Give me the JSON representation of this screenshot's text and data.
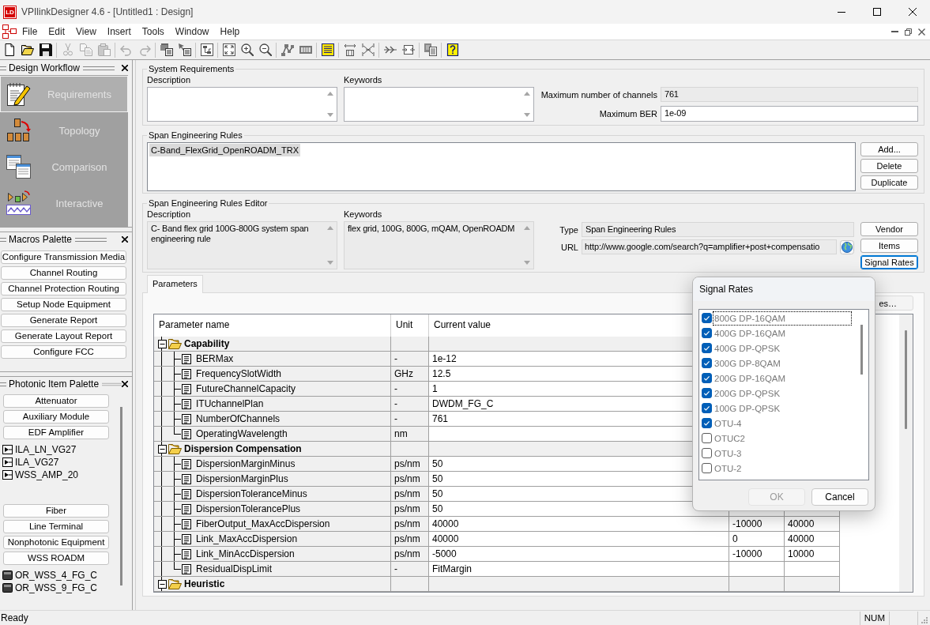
{
  "window": {
    "logo": "LD",
    "title": "VPIlinkDesigner 4.6 - [Untitled1 : Design]"
  },
  "menu": [
    "File",
    "Edit",
    "View",
    "Insert",
    "Tools",
    "Window",
    "Help"
  ],
  "toolbar": [
    [
      {
        "disabled": false
      },
      {
        "disabled": false
      },
      {
        "disabled": false
      }
    ],
    [
      {
        "disabled": true
      },
      {
        "disabled": true
      },
      {
        "disabled": true
      }
    ],
    [
      {
        "disabled": true
      },
      {
        "disabled": true
      }
    ],
    [
      {
        "disabled": false
      },
      {
        "disabled": false
      }
    ],
    [
      {
        "disabled": false
      }
    ],
    [
      {
        "disabled": false
      },
      {
        "disabled": false
      },
      {
        "disabled": false
      }
    ],
    [
      {
        "disabled": false
      },
      {
        "disabled": false
      }
    ],
    [
      {
        "disabled": false
      }
    ],
    [
      {
        "disabled": false
      },
      {
        "disabled": false
      }
    ],
    [
      {
        "disabled": false
      },
      {
        "disabled": false
      }
    ],
    [
      {
        "disabled": false
      }
    ],
    [
      {
        "disabled": false
      }
    ]
  ],
  "workflow": {
    "title": "Design Workflow",
    "items": [
      {
        "label": "Requirements",
        "selected": true
      },
      {
        "label": "Topology",
        "selected": false
      },
      {
        "label": "Comparison",
        "selected": false
      },
      {
        "label": "Interactive",
        "selected": false
      }
    ]
  },
  "macros_palette": {
    "title": "Macros Palette",
    "buttons": [
      "Configure Transmission Media",
      "Channel Routing",
      "Channel Protection Routing",
      "Setup Node Equipment",
      "Generate Report",
      "Generate Layout Report",
      "Configure FCC"
    ]
  },
  "photonic_palette": {
    "title": "Photonic Item Palette",
    "categories": [
      {
        "label": "Attenuator"
      },
      {
        "label": "Auxiliary Module"
      },
      {
        "label": "EDF Amplifier",
        "items": [
          {
            "label": "ILA_LN_VG27",
            "kind": "amplifier"
          },
          {
            "label": "ILA_VG27",
            "kind": "amplifier"
          },
          {
            "label": "WSS_AMP_20",
            "kind": "amplifier"
          }
        ]
      },
      {
        "label": "Fiber"
      },
      {
        "label": "Line Terminal"
      },
      {
        "label": "Nonphotonic Equipment"
      },
      {
        "label": "WSS ROADM",
        "items": [
          {
            "label": "OR_WSS_4_FG_C",
            "kind": "roadm"
          },
          {
            "label": "OR_WSS_9_FG_C",
            "kind": "roadm"
          }
        ]
      }
    ]
  },
  "system_requirements": {
    "title": "System Requirements",
    "description": {
      "label": "Description",
      "readonly": false
    },
    "keywords": {
      "label": "Keywords",
      "readonly": false
    },
    "max_channels": {
      "label": "Maximum number of channels",
      "value": "761",
      "readonly": true
    },
    "max_ber": {
      "label": "Maximum BER",
      "value": "1e-09",
      "readonly": false
    }
  },
  "span_engineering_rules": {
    "title": "Span Engineering Rules",
    "items": [
      {
        "label": "C-Band_FlexGrid_OpenROADM_TRX",
        "selected": true
      }
    ],
    "buttons": [
      "Add...",
      "Delete",
      "Duplicate"
    ]
  },
  "rules_editor": {
    "title": "Span Engineering Rules Editor",
    "description": {
      "label": "Description",
      "value": "C- Band flex grid 100G-800G system span engineering rule",
      "readonly": true
    },
    "keywords": {
      "label": "Keywords",
      "value": "flex grid, 100G, 800G, mQAM, OpenROADM",
      "readonly": true
    },
    "type": {
      "label": "Type",
      "value": "Span Engineering Rules",
      "readonly": true
    },
    "url": {
      "label": "URL",
      "value": "http://www.google.com/search?q=amplifier+post+compensatio",
      "readonly": true
    },
    "buttons": [
      {
        "label": "Vendor",
        "focused": false
      },
      {
        "label": "Items",
        "focused": false
      },
      {
        "label": "Signal Rates",
        "focused": true
      }
    ]
  },
  "tabs": [
    {
      "label": "Parameters",
      "selected": true
    }
  ],
  "parameters": {
    "button": {
      "label": "es…"
    },
    "table": {
      "columns": [
        "Parameter name",
        "Unit",
        "Current value"
      ],
      "groups": [
        {
          "name": "Capability",
          "expanded": true,
          "children": [
            {
              "name": "BERMax",
              "unit": "-",
              "value": "1e-12"
            },
            {
              "name": "FrequencySlotWidth",
              "unit": "GHz",
              "value": "12.5"
            },
            {
              "name": "FutureChannelCapacity",
              "unit": "-",
              "value": "1"
            },
            {
              "name": "ITUchannelPlan",
              "unit": "-",
              "value": "DWDM_FG_C"
            },
            {
              "name": "NumberOfChannels",
              "unit": "-",
              "value": "761"
            },
            {
              "name": "OperatingWavelength",
              "unit": "nm"
            }
          ]
        },
        {
          "name": "Dispersion Compensation",
          "expanded": true,
          "children": [
            {
              "name": "DispersionMarginMinus",
              "unit": "ps/nm",
              "value": "50"
            },
            {
              "name": "DispersionMarginPlus",
              "unit": "ps/nm",
              "value": "50"
            },
            {
              "name": "DispersionToleranceMinus",
              "unit": "ps/nm",
              "value": "50"
            },
            {
              "name": "DispersionTolerancePlus",
              "unit": "ps/nm",
              "value": "50"
            },
            {
              "name": "FiberOutput_MaxAccDispersion",
              "unit": "ps/nm",
              "value": "40000",
              "column_4": "-10000",
              "column_5": "40000"
            },
            {
              "name": "Link_MaxAccDispersion",
              "unit": "ps/nm",
              "value": "40000",
              "column_4": "0",
              "column_5": "40000"
            },
            {
              "name": "Link_MinAccDispersion",
              "unit": "ps/nm",
              "value": "-5000",
              "column_4": "-10000",
              "column_5": "10000"
            },
            {
              "name": "ResidualDispLimit",
              "unit": "-",
              "value": "FitMargin"
            }
          ]
        },
        {
          "name": "Heuristic",
          "expanded": true
        }
      ]
    }
  },
  "dialog": {
    "title": "Signal Rates",
    "items": [
      {
        "label": "800G DP-16QAM",
        "checked": true,
        "focused": true
      },
      {
        "label": "400G DP-16QAM",
        "checked": true,
        "focused": false
      },
      {
        "label": "400G DP-QPSK",
        "checked": true,
        "focused": false
      },
      {
        "label": "300G DP-8QAM",
        "checked": true,
        "focused": false
      },
      {
        "label": "200G DP-16QAM",
        "checked": true,
        "focused": false
      },
      {
        "label": "200G DP-QPSK",
        "checked": true,
        "focused": false
      },
      {
        "label": "100G DP-QPSK",
        "checked": true,
        "focused": false
      },
      {
        "label": "OTU-4",
        "checked": true,
        "focused": false
      },
      {
        "label": "OTUC2",
        "checked": false,
        "focused": false
      },
      {
        "label": "OTU-3",
        "checked": false,
        "focused": false
      },
      {
        "label": "OTU-2",
        "checked": false,
        "focused": false
      }
    ],
    "buttons": [
      {
        "label": "OK",
        "disabled": true
      },
      {
        "label": "Cancel",
        "disabled": false
      }
    ]
  },
  "status_bar": {
    "text": "Ready",
    "indicators": [
      "NUM"
    ]
  }
}
